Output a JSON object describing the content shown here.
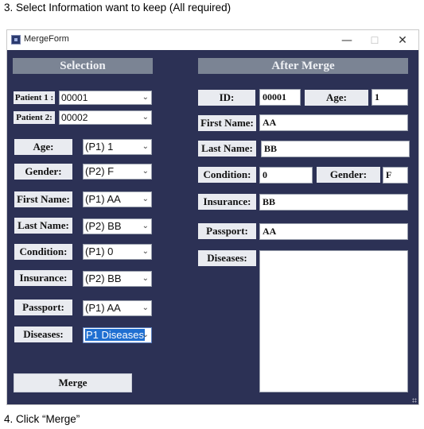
{
  "instructions": {
    "step3": "3.   Select Information want to keep (All required)",
    "step4": "4.   Click “Merge”"
  },
  "window": {
    "title": "MergeForm",
    "minimize_glyph": "—",
    "maximize_glyph": "☐",
    "close_glyph": "✕"
  },
  "selection": {
    "header": "Selection",
    "patient1": {
      "label": "Patient 1 :",
      "value": "00001"
    },
    "patient2": {
      "label": "Patient 2:",
      "value": "00002"
    },
    "rows": [
      {
        "label": "Age:",
        "value": "(P1) 1"
      },
      {
        "label": "Gender:",
        "value": "(P2) F"
      },
      {
        "label": "First Name:",
        "value": "(P1) AA"
      },
      {
        "label": "Last Name:",
        "value": "(P2) BB"
      },
      {
        "label": "Condition:",
        "value": "(P1) 0"
      },
      {
        "label": "Insurance:",
        "value": "(P2) BB"
      },
      {
        "label": "Passport:",
        "value": "(P1) AA"
      },
      {
        "label": "Diseases:",
        "value": "P1 Diseases"
      }
    ],
    "merge_label": "Merge",
    "chevron": "⌄"
  },
  "after_merge": {
    "header": "After Merge",
    "id_label": "ID:",
    "id_value": "00001",
    "age_label": "Age:",
    "age_value": "1",
    "first_name_label": "First Name:",
    "first_name_value": "AA",
    "last_name_label": "Last Name:",
    "last_name_value": "BB",
    "condition_label": "Condition:",
    "condition_value": "0",
    "gender_label": "Gender:",
    "gender_value": "F",
    "insurance_label": "Insurance:",
    "insurance_value": "BB",
    "passport_label": "Passport:",
    "passport_value": "AA",
    "diseases_label": "Diseases:",
    "diseases_value": ""
  },
  "colors": {
    "form_background": "#2c3155",
    "header_background": "#7b8494",
    "label_background": "#e9ebf0",
    "selection_highlight": "#1f6fd1"
  }
}
